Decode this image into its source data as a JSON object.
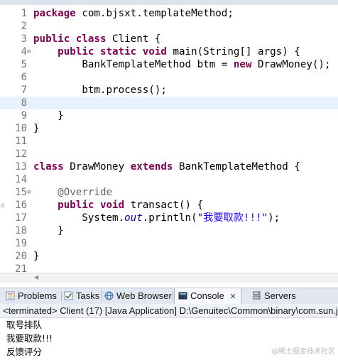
{
  "editor": {
    "lines": [
      {
        "num": "1",
        "fold": "",
        "segments": [
          {
            "t": "package",
            "c": "kw"
          },
          {
            "t": " com.bjsxt.templateMethod;",
            "c": ""
          }
        ]
      },
      {
        "num": "2",
        "fold": "",
        "segments": []
      },
      {
        "num": "3",
        "fold": "",
        "segments": [
          {
            "t": "public",
            "c": "kw"
          },
          {
            "t": " ",
            "c": ""
          },
          {
            "t": "class",
            "c": "kw"
          },
          {
            "t": " Client {",
            "c": ""
          }
        ]
      },
      {
        "num": "4",
        "fold": "⊖",
        "segments": [
          {
            "t": "    ",
            "c": ""
          },
          {
            "t": "public",
            "c": "kw"
          },
          {
            "t": " ",
            "c": ""
          },
          {
            "t": "static",
            "c": "kw"
          },
          {
            "t": " ",
            "c": ""
          },
          {
            "t": "void",
            "c": "kw"
          },
          {
            "t": " main(String[] args) {",
            "c": ""
          }
        ]
      },
      {
        "num": "5",
        "fold": "",
        "segments": [
          {
            "t": "        BankTemplateMethod btm = ",
            "c": ""
          },
          {
            "t": "new",
            "c": "kw"
          },
          {
            "t": " DrawMoney();",
            "c": ""
          }
        ]
      },
      {
        "num": "6",
        "fold": "",
        "segments": []
      },
      {
        "num": "7",
        "fold": "",
        "segments": [
          {
            "t": "        btm.process();",
            "c": ""
          }
        ]
      },
      {
        "num": "8",
        "fold": "",
        "segments": []
      },
      {
        "num": "9",
        "fold": "",
        "segments": [
          {
            "t": "    }",
            "c": ""
          }
        ]
      },
      {
        "num": "10",
        "fold": "",
        "segments": [
          {
            "t": "}",
            "c": ""
          }
        ]
      },
      {
        "num": "11",
        "fold": "",
        "segments": []
      },
      {
        "num": "12",
        "fold": "",
        "segments": []
      },
      {
        "num": "13",
        "fold": "",
        "segments": [
          {
            "t": "class",
            "c": "kw"
          },
          {
            "t": " DrawMoney ",
            "c": ""
          },
          {
            "t": "extends",
            "c": "kw"
          },
          {
            "t": " BankTemplateMethod {",
            "c": ""
          }
        ]
      },
      {
        "num": "14",
        "fold": "",
        "segments": []
      },
      {
        "num": "15",
        "fold": "⊖",
        "segments": [
          {
            "t": "    ",
            "c": ""
          },
          {
            "t": "@Override",
            "c": "ann"
          }
        ]
      },
      {
        "num": "16",
        "fold": "△",
        "segments": [
          {
            "t": "    ",
            "c": ""
          },
          {
            "t": "public",
            "c": "kw"
          },
          {
            "t": " ",
            "c": ""
          },
          {
            "t": "void",
            "c": "kw"
          },
          {
            "t": " transact() {",
            "c": ""
          }
        ]
      },
      {
        "num": "17",
        "fold": "",
        "segments": [
          {
            "t": "        System.",
            "c": ""
          },
          {
            "t": "out",
            "c": "ital"
          },
          {
            "t": ".println(",
            "c": ""
          },
          {
            "t": "\"我要取款!!!\"",
            "c": "str"
          },
          {
            "t": ");",
            "c": ""
          }
        ]
      },
      {
        "num": "18",
        "fold": "",
        "segments": [
          {
            "t": "    }",
            "c": ""
          }
        ]
      },
      {
        "num": "19",
        "fold": "",
        "segments": []
      },
      {
        "num": "20",
        "fold": "",
        "segments": [
          {
            "t": "}",
            "c": ""
          }
        ]
      },
      {
        "num": "21",
        "fold": "",
        "segments": []
      }
    ],
    "current_line": "8"
  },
  "views": {
    "tabs": [
      {
        "label": "Problems",
        "icon": "problems-icon",
        "active": false
      },
      {
        "label": "Tasks",
        "icon": "tasks-icon",
        "active": false
      },
      {
        "label": "Web Browser",
        "icon": "web-browser-icon",
        "active": false
      },
      {
        "label": "Console",
        "icon": "console-icon",
        "active": true
      },
      {
        "label": "Servers",
        "icon": "servers-icon",
        "active": false
      }
    ]
  },
  "console": {
    "header": "<terminated> Client (17) [Java Application] D:\\Genuitec\\Common\\binary\\com.sun.java",
    "output": [
      "取号排队",
      "我要取款!!!",
      "反馈评分"
    ]
  },
  "watermark": "@稀土掘金技术社区",
  "colors": {
    "keyword": "#7f0055",
    "string": "#2a00ff",
    "annotation": "#646464",
    "field": "#0000c0",
    "current_line": "#e8f2fe"
  }
}
